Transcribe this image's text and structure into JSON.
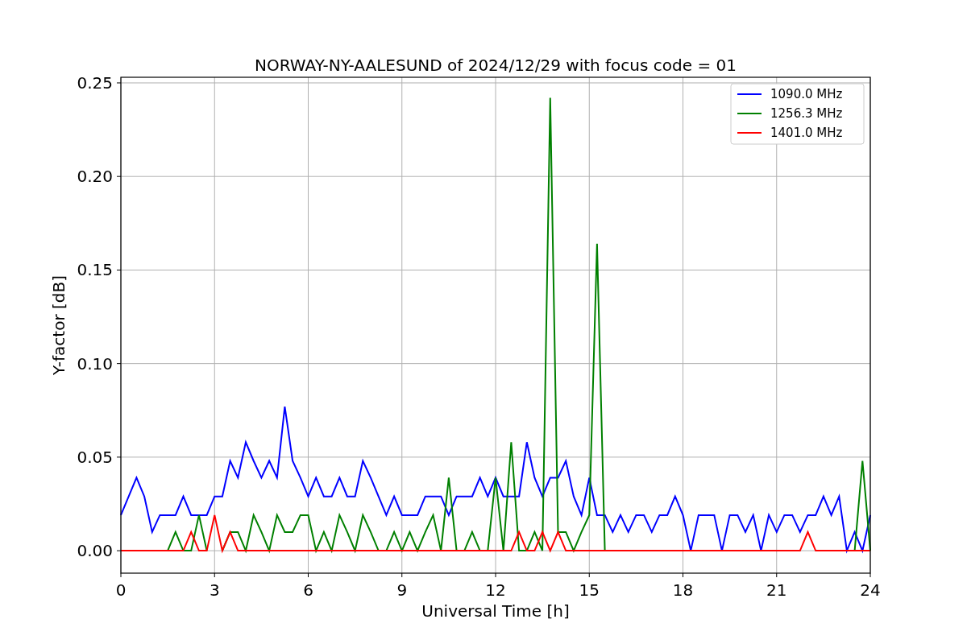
{
  "chart_data": {
    "type": "line",
    "title": "NORWAY-NY-AALESUND of 2024/12/29 with focus code = 01",
    "xlabel": "Universal Time [h]",
    "ylabel": "Y-factor [dB]",
    "x": [
      0,
      0.25,
      0.5,
      0.75,
      1,
      1.25,
      1.5,
      1.75,
      2,
      2.25,
      2.5,
      2.75,
      3,
      3.25,
      3.5,
      3.75,
      4,
      4.25,
      4.5,
      4.75,
      5,
      5.25,
      5.5,
      5.75,
      6,
      6.25,
      6.5,
      6.75,
      7,
      7.25,
      7.5,
      7.75,
      8,
      8.25,
      8.5,
      8.75,
      9,
      9.25,
      9.5,
      9.75,
      10,
      10.25,
      10.5,
      10.75,
      11,
      11.25,
      11.5,
      11.75,
      12,
      12.25,
      12.5,
      12.75,
      13,
      13.25,
      13.5,
      13.75,
      14,
      14.25,
      14.5,
      14.75,
      15,
      15.25,
      15.5,
      15.75,
      16,
      16.25,
      16.5,
      16.75,
      17,
      17.25,
      17.5,
      17.75,
      18,
      18.25,
      18.5,
      18.75,
      19,
      19.25,
      19.5,
      19.75,
      20,
      20.25,
      20.5,
      20.75,
      21,
      21.25,
      21.5,
      21.75,
      22,
      22.25,
      22.5,
      22.75,
      23,
      23.25,
      23.5,
      23.75,
      24
    ],
    "series": [
      {
        "name": "1090.0 MHz",
        "color": "#0000ff",
        "values": [
          0.019,
          0.029,
          0.039,
          0.029,
          0.01,
          0.019,
          0.019,
          0.019,
          0.029,
          0.019,
          0.019,
          0.019,
          0.029,
          0.029,
          0.048,
          0.039,
          0.058,
          0.048,
          0.039,
          0.048,
          0.039,
          0.077,
          0.048,
          0.039,
          0.029,
          0.039,
          0.029,
          0.029,
          0.039,
          0.029,
          0.029,
          0.048,
          0.039,
          0.029,
          0.019,
          0.029,
          0.019,
          0.019,
          0.019,
          0.029,
          0.029,
          0.029,
          0.019,
          0.029,
          0.029,
          0.029,
          0.039,
          0.029,
          0.039,
          0.029,
          0.029,
          0.029,
          0.058,
          0.039,
          0.029,
          0.039,
          0.039,
          0.048,
          0.029,
          0.019,
          0.039,
          0.019,
          0.019,
          0.01,
          0.019,
          0.01,
          0.019,
          0.019,
          0.01,
          0.019,
          0.019,
          0.029,
          0.019,
          0,
          0.019,
          0.019,
          0.019,
          0,
          0.019,
          0.019,
          0.01,
          0.019,
          0,
          0.019,
          0.01,
          0.019,
          0.019,
          0.01,
          0.019,
          0.019,
          0.029,
          0.019,
          0.029,
          0,
          0.01,
          0,
          0.019
        ]
      },
      {
        "name": "1256.3 MHz",
        "color": "#008000",
        "values": [
          null,
          null,
          null,
          null,
          null,
          null,
          0,
          0.01,
          0,
          0,
          0.019,
          0,
          null,
          0,
          0.01,
          0.01,
          0,
          0.019,
          0.01,
          0,
          0.019,
          0.01,
          0.01,
          0.019,
          0.019,
          0,
          0.01,
          0,
          0.019,
          0.01,
          0,
          0.019,
          0.01,
          0,
          0,
          0.01,
          0,
          0.01,
          0,
          0.01,
          0.019,
          0,
          0.039,
          0,
          0,
          0.01,
          0,
          0,
          0.039,
          0,
          0.058,
          0,
          0,
          0.01,
          0,
          0.242,
          0.01,
          0.01,
          0,
          0.01,
          0.019,
          0.164,
          0,
          null,
          null,
          null,
          null,
          null,
          null,
          null,
          null,
          null,
          null,
          null,
          null,
          null,
          null,
          null,
          null,
          null,
          null,
          null,
          null,
          null,
          null,
          null,
          null,
          null,
          null,
          null,
          null,
          null,
          null,
          null,
          0,
          0.048,
          0
        ]
      },
      {
        "name": "1401.0 MHz",
        "color": "#ff0000",
        "values": [
          0,
          0,
          0,
          0,
          0,
          0,
          0,
          0,
          0,
          0.01,
          0,
          0,
          0.019,
          0,
          0.01,
          0,
          0,
          0,
          0,
          0,
          0,
          0,
          0,
          0,
          0,
          0,
          0,
          0,
          0,
          0,
          0,
          0,
          0,
          0,
          0,
          0,
          0,
          0,
          0,
          0,
          0,
          0,
          0,
          0,
          0,
          0,
          0,
          0,
          0,
          0,
          0,
          0.01,
          0,
          0,
          0.01,
          0,
          0.01,
          0,
          0,
          0,
          0,
          0,
          0,
          0,
          0,
          0,
          0,
          0,
          0,
          0,
          0,
          0,
          0,
          0,
          0,
          0,
          0,
          0,
          0,
          0,
          0,
          0,
          0,
          0,
          0,
          0,
          0,
          0,
          0.01,
          0,
          0,
          0,
          0,
          0,
          0,
          0,
          0
        ]
      }
    ],
    "xlim": [
      0,
      24
    ],
    "ylim": [
      -0.012,
      0.253
    ],
    "grid": true,
    "legend": "upper right",
    "xticks": [
      0,
      3,
      6,
      9,
      12,
      15,
      18,
      21,
      24
    ],
    "yticks": [
      {
        "value": 0,
        "label": "0.00"
      },
      {
        "value": 0.05,
        "label": "0.05"
      },
      {
        "value": 0.1,
        "label": "0.10"
      },
      {
        "value": 0.15,
        "label": "0.15"
      },
      {
        "value": 0.2,
        "label": "0.20"
      },
      {
        "value": 0.25,
        "label": "0.25"
      }
    ]
  }
}
